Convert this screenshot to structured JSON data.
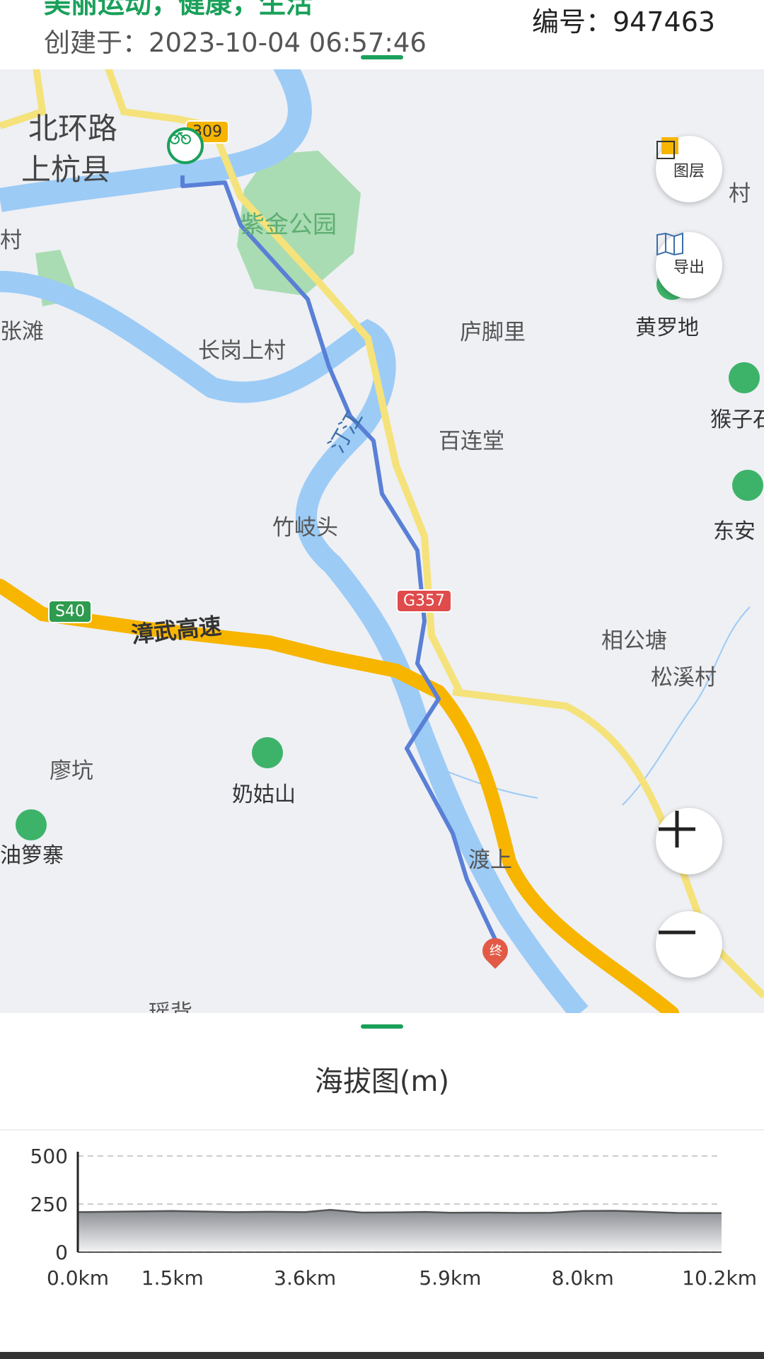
{
  "header": {
    "title": "美丽运动，健康，生活",
    "created": "创建于：2023-10-04 06:57:46",
    "serial": "编号：947463"
  },
  "map": {
    "labels": {
      "beihuanlu": "北环路",
      "shanghangxian": "上杭县",
      "zijin_park": "紫金公园",
      "zhangtan": "张滩",
      "changgang": "长岗上村",
      "lujiaoli": "庐脚里",
      "huangluodi": "黄罗地",
      "houzi": "猴子石",
      "tingjiang": "汀江",
      "bailiantang": "百连堂",
      "zhuqitou": "竹岐头",
      "dongan": "东安",
      "zhangwu": "漳武高速",
      "xianggongtang": "相公塘",
      "songxicun": "松溪村",
      "liaokeng": "廖坑",
      "naigushan": "奶姑山",
      "youluozhai": "油箩寨",
      "dushang": "渡上",
      "yaobei": "瑶背",
      "cun_left": "村",
      "cun_right": "村"
    },
    "shields": {
      "s40": "S40",
      "g357": "G357",
      "r09": "309"
    },
    "end_marker": "终",
    "buttons": {
      "layers": "图层",
      "export": "导出"
    },
    "colors": {
      "water": "#9ccbf6",
      "highway": "#f7b500",
      "road": "#f5e27a",
      "route": "#5a7fd6",
      "park": "#a9dcb2"
    }
  },
  "elevation": {
    "title": "海拔图(m)"
  },
  "chart_data": {
    "type": "area",
    "title": "海拔图(m)",
    "xlabel": "",
    "ylabel": "",
    "ylim": [
      0,
      500
    ],
    "yticks": [
      "0",
      "250",
      "500"
    ],
    "xticks": [
      "0.0km",
      "1.5km",
      "3.6km",
      "5.9km",
      "8.0km",
      "10.2km"
    ],
    "grid": true,
    "x": [
      0.0,
      0.5,
      1.0,
      1.5,
      2.0,
      2.5,
      3.0,
      3.6,
      4.0,
      4.5,
      5.0,
      5.5,
      5.9,
      6.5,
      7.0,
      7.5,
      8.0,
      8.5,
      9.0,
      9.5,
      10.2
    ],
    "values": [
      208,
      210,
      212,
      214,
      211,
      208,
      210,
      208,
      220,
      206,
      207,
      209,
      205,
      206,
      204,
      205,
      214,
      215,
      210,
      204,
      203
    ]
  }
}
